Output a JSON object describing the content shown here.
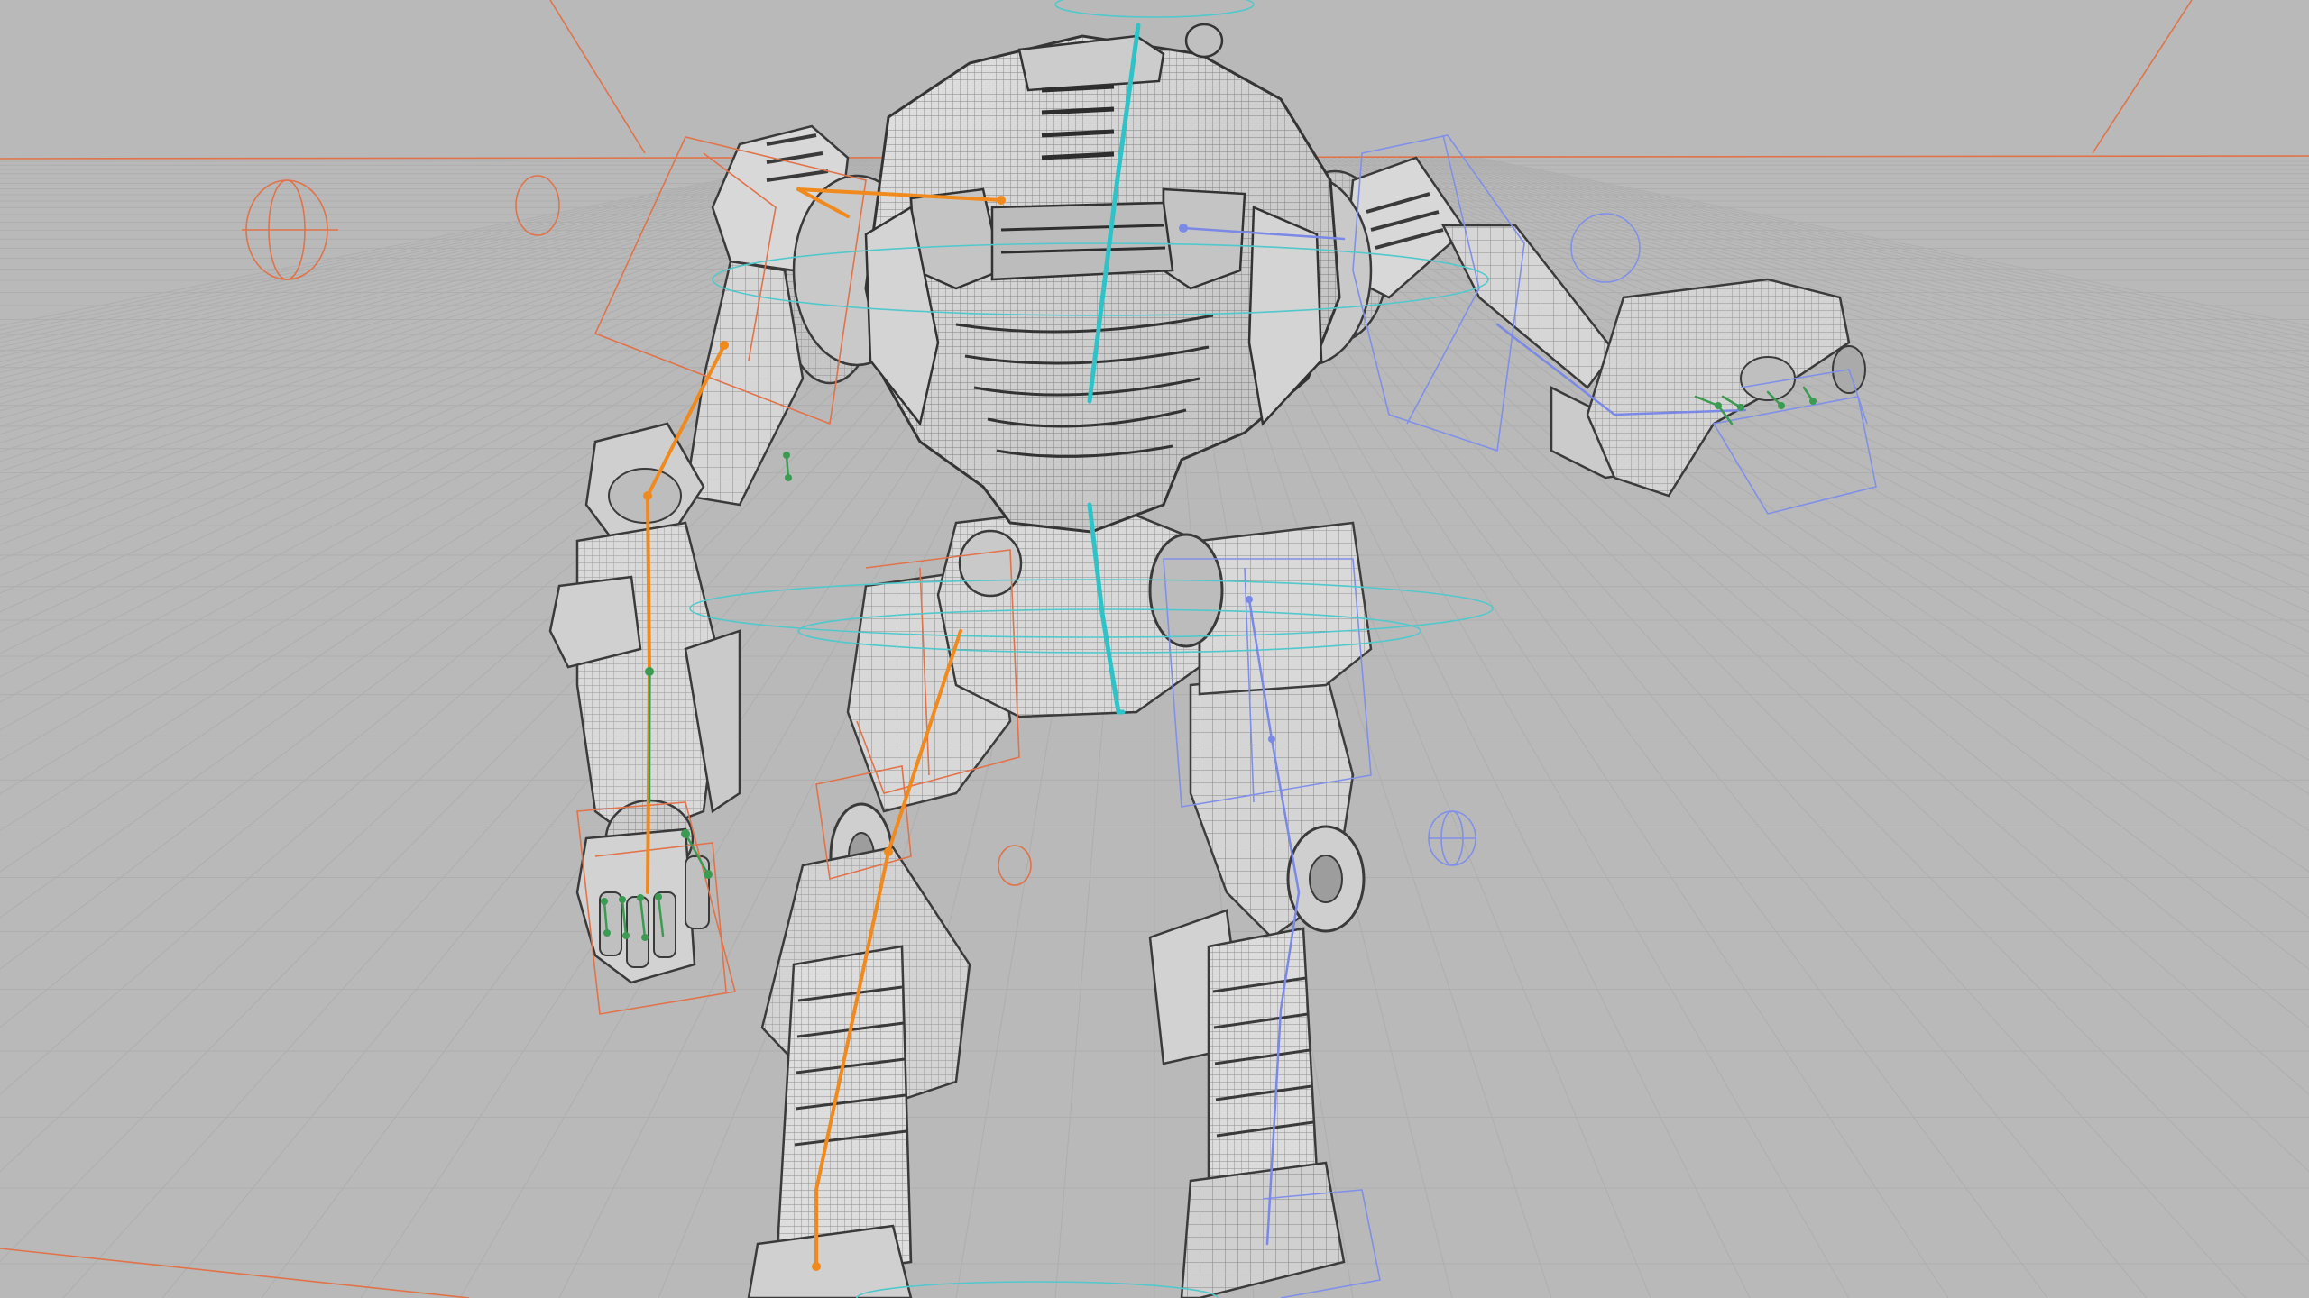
{
  "viewport": {
    "kind": "3d-viewport",
    "shading": "wireframe-on-shaded",
    "subject": "bipedal-mech-rig"
  },
  "colors": {
    "background": "#b9b9b9",
    "grid_line": "#aeaeae",
    "horizon": "#e0734a",
    "mesh_fill": "#d6d6d6",
    "mesh_wire": "#4a4a4a",
    "spine_bone": "#2fc3c8",
    "left_bone": "#f08a1e",
    "right_bone": "#7a88e6",
    "finger_bone": "#3c9b52",
    "left_control": "#e0734a",
    "right_control": "#8090e8",
    "center_control": "#52c8cc"
  },
  "rig": {
    "chains": [
      {
        "name": "spine",
        "color_key": "spine_bone"
      },
      {
        "name": "left-arm",
        "color_key": "left_bone"
      },
      {
        "name": "right-arm",
        "color_key": "right_bone"
      },
      {
        "name": "left-leg",
        "color_key": "left_bone"
      },
      {
        "name": "right-leg",
        "color_key": "right_bone"
      },
      {
        "name": "fingers",
        "color_key": "finger_bone"
      }
    ]
  }
}
